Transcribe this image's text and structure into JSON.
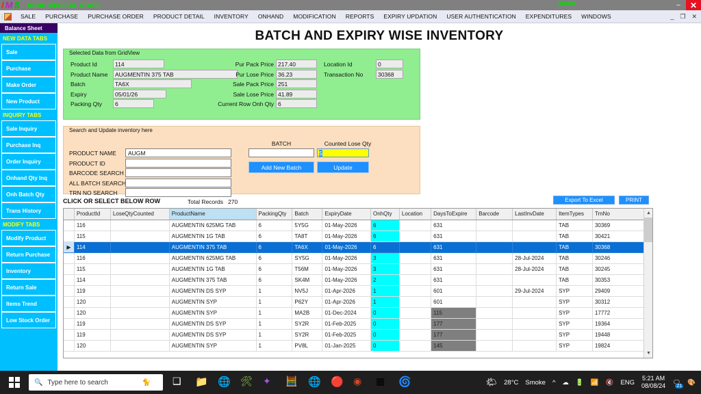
{
  "titlebar": {
    "logo_letters": [
      "I",
      "M",
      "S"
    ],
    "app_title": "DEMO MEDICAL STORE",
    "user": "ADMIN",
    "minimize": "–",
    "close": "✕"
  },
  "menubar": {
    "items": [
      "SALE",
      "PURCHASE",
      "PURCHASE ORDER",
      "PRODUCT DETAIL",
      "INVENTORY",
      "ONHAND",
      "MODIFICATION",
      "REPORTS",
      "EXPIRY UPDATION",
      "USER AUTHENTICATION",
      "EXPENDITURES",
      "WINDOWS"
    ],
    "win_minimize": "_",
    "win_restore": "❐",
    "win_close": "✕"
  },
  "sidebar": {
    "top_item": "Balance Sheet",
    "groups": [
      {
        "header": "NEW DATA TABS",
        "items": [
          "Sale",
          "Purchase",
          "Make Order",
          "New Product"
        ]
      },
      {
        "header": "INQUIRY TABS",
        "items": [
          "Sale Inquiry",
          "Purchase Inq",
          "Order Inquiry",
          "Onhand Qty Inq",
          "Onh Batch Qty",
          "Trans History"
        ]
      },
      {
        "header": "MODIFY TABS",
        "items": [
          "Modify Product",
          "Return Purchase",
          "Inventory",
          "Return Sale",
          "Items Trend",
          "Low Stock Order"
        ]
      }
    ]
  },
  "page": {
    "title": "BATCH AND EXPIRY WISE INVENTORY"
  },
  "selected_data": {
    "legend": "Selected Data from GridView",
    "left_fields": [
      {
        "label": "Product Id",
        "value": "114"
      },
      {
        "label": "Product Name",
        "value": "AUGMENTIN 375 TAB"
      },
      {
        "label": "Batch",
        "value": "TA6X"
      },
      {
        "label": "Expiry",
        "value": "05/01/26"
      },
      {
        "label": "Packing Qty",
        "value": "6"
      }
    ],
    "mid_fields": [
      {
        "label": "Pur Pack Price",
        "value": "217.40"
      },
      {
        "label": "Pur Lose Price",
        "value": "36.23"
      },
      {
        "label": "Sale Pack Price",
        "value": "251"
      },
      {
        "label": "Sale Lose Price",
        "value": "41.89"
      },
      {
        "label": "Current Row Onh Qty",
        "value": "6"
      }
    ],
    "right_fields": [
      {
        "label": "Location Id",
        "value": "0"
      },
      {
        "label": "Transaction No",
        "value": "30368"
      }
    ]
  },
  "search_panel": {
    "legend": "Search and Update inventory here",
    "fields": [
      {
        "label": "PRODUCT NAME",
        "value": "AUGM"
      },
      {
        "label": "PRODUCT ID",
        "value": ""
      },
      {
        "label": "BARCODE SEARCH",
        "value": ""
      },
      {
        "label": "ALL BATCH SEARCH",
        "value": ""
      },
      {
        "label": "TRN NO SEARCH",
        "value": ""
      }
    ],
    "batch_label": "BATCH",
    "batch_value": "",
    "counted_label": "Counted Lose Qty",
    "counted_value": "5",
    "add_batch_button": "Add New Batch",
    "update_button": "Update"
  },
  "grid_toolbar": {
    "click_hint": "CLICK OR SELECT BELOW ROW",
    "total_records_label": "Total Records",
    "total_records_value": "270",
    "export_button": "Export To Excel",
    "print_button": "PRINT"
  },
  "grid": {
    "columns": [
      "ProductId",
      "LoseQtyCounted",
      "ProductName",
      "PackingQty",
      "Batch",
      "ExpiryDate",
      "OnhQty",
      "Location",
      "DaysToExpire",
      "Barcode",
      "LastInvDate",
      "ItemTypes",
      "TrnNo"
    ],
    "selected_column": "ProductName",
    "selected_row_index": 2,
    "rows": [
      {
        "ProductId": "116",
        "LoseQtyCounted": "",
        "ProductName": "AUGMENTIN 625MG TAB",
        "PackingQty": "6",
        "Batch": "5Y5G",
        "ExpiryDate": "01-May-2026",
        "OnhQty": "6",
        "Location": "",
        "DaysToExpire": "631",
        "Barcode": "",
        "LastInvDate": "",
        "ItemTypes": "TAB",
        "TrnNo": "30369",
        "days_warn": false
      },
      {
        "ProductId": "115",
        "LoseQtyCounted": "",
        "ProductName": "AUGMENTIN 1G TAB",
        "PackingQty": "6",
        "Batch": "TA8T",
        "ExpiryDate": "01-May-2026",
        "OnhQty": "6",
        "Location": "",
        "DaysToExpire": "631",
        "Barcode": "",
        "LastInvDate": "",
        "ItemTypes": "TAB",
        "TrnNo": "30421",
        "days_warn": false
      },
      {
        "ProductId": "114",
        "LoseQtyCounted": "",
        "ProductName": "AUGMENTIN 375 TAB",
        "PackingQty": "6",
        "Batch": "TA6X",
        "ExpiryDate": "01-May-2026",
        "OnhQty": "6",
        "Location": "",
        "DaysToExpire": "631",
        "Barcode": "",
        "LastInvDate": "",
        "ItemTypes": "TAB",
        "TrnNo": "30368",
        "days_warn": false
      },
      {
        "ProductId": "116",
        "LoseQtyCounted": "",
        "ProductName": "AUGMENTIN 625MG TAB",
        "PackingQty": "6",
        "Batch": "SY5G",
        "ExpiryDate": "01-May-2026",
        "OnhQty": "3",
        "Location": "",
        "DaysToExpire": "631",
        "Barcode": "",
        "LastInvDate": "28-Jul-2024",
        "ItemTypes": "TAB",
        "TrnNo": "30246",
        "days_warn": false
      },
      {
        "ProductId": "115",
        "LoseQtyCounted": "",
        "ProductName": "AUGMENTIN 1G TAB",
        "PackingQty": "6",
        "Batch": "T56M",
        "ExpiryDate": "01-May-2026",
        "OnhQty": "3",
        "Location": "",
        "DaysToExpire": "631",
        "Barcode": "",
        "LastInvDate": "28-Jul-2024",
        "ItemTypes": "TAB",
        "TrnNo": "30245",
        "days_warn": false
      },
      {
        "ProductId": "114",
        "LoseQtyCounted": "",
        "ProductName": "AUGMENTIN 375 TAB",
        "PackingQty": "6",
        "Batch": "SK4M",
        "ExpiryDate": "01-May-2026",
        "OnhQty": "2",
        "Location": "",
        "DaysToExpire": "631",
        "Barcode": "",
        "LastInvDate": "",
        "ItemTypes": "TAB",
        "TrnNo": "30353",
        "days_warn": false
      },
      {
        "ProductId": "119",
        "LoseQtyCounted": "",
        "ProductName": "AUGMENTIN DS SYP",
        "PackingQty": "1",
        "Batch": "NV5J",
        "ExpiryDate": "01-Apr-2026",
        "OnhQty": "1",
        "Location": "",
        "DaysToExpire": "601",
        "Barcode": "",
        "LastInvDate": "29-Jul-2024",
        "ItemTypes": "SYP",
        "TrnNo": "29409",
        "days_warn": false
      },
      {
        "ProductId": "120",
        "LoseQtyCounted": "",
        "ProductName": "AUGMENTIN SYP",
        "PackingQty": "1",
        "Batch": "P62Y",
        "ExpiryDate": "01-Apr-2026",
        "OnhQty": "1",
        "Location": "",
        "DaysToExpire": "601",
        "Barcode": "",
        "LastInvDate": "",
        "ItemTypes": "SYP",
        "TrnNo": "30312",
        "days_warn": false
      },
      {
        "ProductId": "120",
        "LoseQtyCounted": "",
        "ProductName": "AUGMENTIN SYP",
        "PackingQty": "1",
        "Batch": "MA2B",
        "ExpiryDate": "01-Dec-2024",
        "OnhQty": "0",
        "Location": "",
        "DaysToExpire": "115",
        "Barcode": "",
        "LastInvDate": "",
        "ItemTypes": "SYP",
        "TrnNo": "17772",
        "days_warn": true
      },
      {
        "ProductId": "119",
        "LoseQtyCounted": "",
        "ProductName": "AUGMENTIN DS SYP",
        "PackingQty": "1",
        "Batch": "SY2R",
        "ExpiryDate": "01-Feb-2025",
        "OnhQty": "0",
        "Location": "",
        "DaysToExpire": "177",
        "Barcode": "",
        "LastInvDate": "",
        "ItemTypes": "SYP",
        "TrnNo": "19364",
        "days_warn": true
      },
      {
        "ProductId": "119",
        "LoseQtyCounted": "",
        "ProductName": "AUGMENTIN DS SYP",
        "PackingQty": "1",
        "Batch": "SY2R",
        "ExpiryDate": "01-Feb-2025",
        "OnhQty": "0",
        "Location": "",
        "DaysToExpire": "177",
        "Barcode": "",
        "LastInvDate": "",
        "ItemTypes": "SYP",
        "TrnNo": "19448",
        "days_warn": true
      },
      {
        "ProductId": "120",
        "LoseQtyCounted": "",
        "ProductName": "AUGMENTIN SYP",
        "PackingQty": "1",
        "Batch": "PV8L",
        "ExpiryDate": "01-Jan-2025",
        "OnhQty": "0",
        "Location": "",
        "DaysToExpire": "145",
        "Barcode": "",
        "LastInvDate": "",
        "ItemTypes": "SYP",
        "TrnNo": "19824",
        "days_warn": true
      }
    ]
  },
  "taskbar": {
    "search_placeholder": "Type here to search",
    "weather_temp": "28°C",
    "weather_desc": "Smoke",
    "language": "ENG",
    "time": "5:21 AM",
    "date": "08/08/24",
    "notification_count": "21"
  },
  "colors": {
    "titlebar_bg": "#808080",
    "accent_green": "#90ee90",
    "accent_peach": "#fbdfc0",
    "sidebar_bg": "#00bfff",
    "selection_blue": "#0a6fd4",
    "cyan_cell": "#00ffff",
    "warn_gray": "#7f7f7f",
    "button_blue": "#1e90ff",
    "yellow_field": "#ffff00"
  }
}
